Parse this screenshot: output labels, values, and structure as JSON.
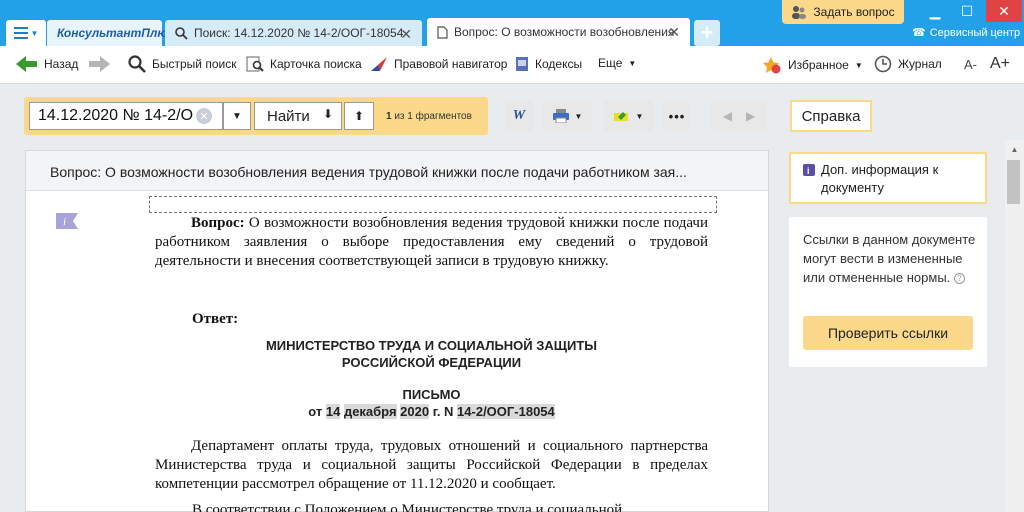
{
  "titlebar": {
    "brand": "КонсультантПлюс",
    "tabs": [
      {
        "label": "Поиск: 14.12.2020 № 14-2/ООГ-18054"
      },
      {
        "label": "Вопрос: О возможности возобновления"
      }
    ],
    "ask_button": "Задать вопрос",
    "service_center": "Сервисный центр"
  },
  "toolbar": {
    "back": "Назад",
    "quick_search": "Быстрый поиск",
    "search_card": "Карточка поиска",
    "legal_navigator": "Правовой навигатор",
    "codes": "Кодексы",
    "more": "Еще",
    "favorites": "Избранное",
    "journal": "Журнал",
    "font_smaller": "A-",
    "font_larger": "A+"
  },
  "search": {
    "value": "14.12.2020 № 14-2/О",
    "find_label": "Найти",
    "fragments_count": "1",
    "fragments_text": "из 1 фрагментов"
  },
  "right": {
    "spravka": "Справка",
    "dop_info": "Доп. информация к документу",
    "links_text": "Ссылки в данном документе могут вести в измененные или отмененные нормы.",
    "check_links": "Проверить ссылки"
  },
  "document": {
    "header": "Вопрос: О возможности возобновления ведения трудовой книжки после подачи работником зая...",
    "question_label": "Вопрос:",
    "question_text": " О возможности возобновления ведения трудовой книжки после подачи работником заявления о выборе предоставления ему сведений о трудовой деятельности и внесения соответствующей записи в трудовую книжку.",
    "answer_label": "Ответ:",
    "ministry_line1": "МИНИСТЕРСТВО ТРУДА И СОЦИАЛЬНОЙ ЗАЩИТЫ",
    "ministry_line2": "РОССИЙСКОЙ ФЕДЕРАЦИИ",
    "letter": "ПИСЬМО",
    "date_prefix": "от ",
    "date_day": "14",
    "date_month": "декабря",
    "date_year": "2020",
    "date_mid": " г. N ",
    "date_num1": "14",
    "date_num2": "-2/ООГ-18054",
    "body": "Департамент оплаты труда, трудовых отношений и социального партнерства Министерства труда и социальной защиты Российской Федерации в пределах компетенции рассмотрел обращение от 11.12.2020 и сообщает.",
    "cut_line": "В соответствии с Положением о Министерстве труда и социальной"
  },
  "colors": {
    "accent": "#22a0e8",
    "highlight": "#fcd98a"
  }
}
